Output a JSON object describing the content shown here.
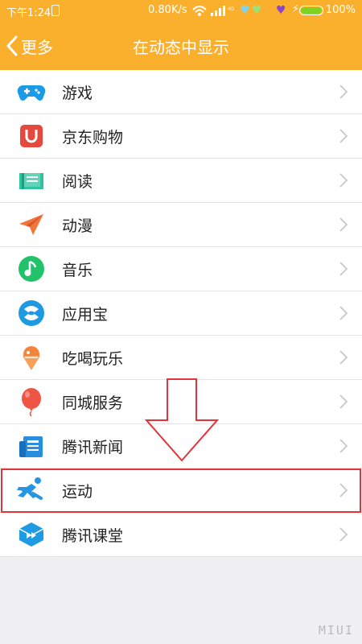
{
  "status_bar": {
    "time": "下午1:24",
    "speed": "0.80K/s",
    "battery": "100%",
    "battery_level": 1.0
  },
  "nav": {
    "back_label": "更多",
    "title": "在动态中显示"
  },
  "items": [
    {
      "label": "游戏",
      "icon": "gamepad-icon",
      "color": "#1a9be8"
    },
    {
      "label": "京东购物",
      "icon": "jd-shopping-icon",
      "color": "#e5483c"
    },
    {
      "label": "阅读",
      "icon": "book-icon",
      "color": "#2fc3a0"
    },
    {
      "label": "动漫",
      "icon": "paper-plane-icon",
      "color": "#f4743a"
    },
    {
      "label": "音乐",
      "icon": "music-note-icon",
      "color": "#22c26a"
    },
    {
      "label": "应用宝",
      "icon": "app-treasure-icon",
      "color": "#1d9ae2"
    },
    {
      "label": "吃喝玩乐",
      "icon": "ice-cream-icon",
      "color": "#f5843b"
    },
    {
      "label": "同城服务",
      "icon": "balloon-icon",
      "color": "#ef5544"
    },
    {
      "label": "腾讯新闻",
      "icon": "newspaper-icon",
      "color": "#2a8ee0"
    },
    {
      "label": "运动",
      "icon": "runner-icon",
      "color": "#2696e3"
    },
    {
      "label": "腾讯课堂",
      "icon": "classroom-icon",
      "color": "#1f9ae4"
    }
  ],
  "colors": {
    "header": "#fbb02d",
    "highlight": "#e0353b",
    "chevron": "#c7c7cc"
  },
  "watermark": "MIUI"
}
